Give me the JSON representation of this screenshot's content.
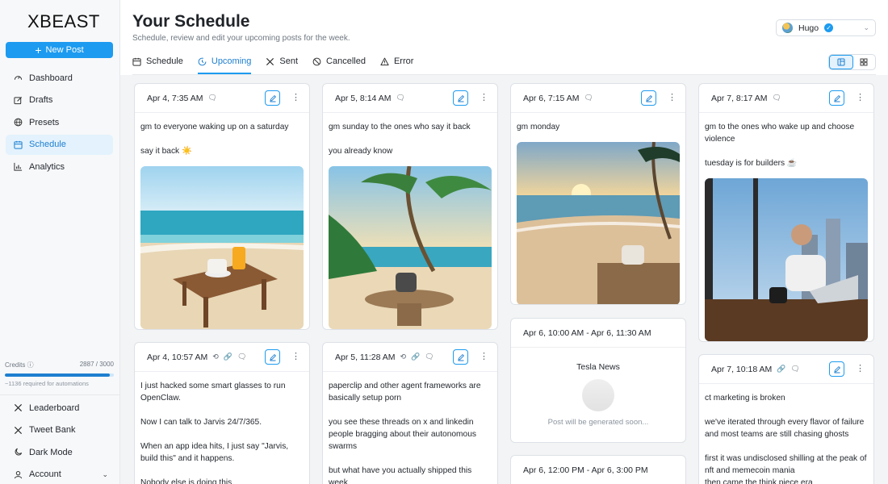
{
  "app": {
    "logo": "XBEAST",
    "new_post": "New Post"
  },
  "nav": [
    {
      "label": "Dashboard",
      "icon": "gauge-icon"
    },
    {
      "label": "Drafts",
      "icon": "pencil-square-icon"
    },
    {
      "label": "Presets",
      "icon": "globe-icon"
    },
    {
      "label": "Schedule",
      "icon": "calendar-icon",
      "active": true
    },
    {
      "label": "Analytics",
      "icon": "bar-chart-icon"
    }
  ],
  "credits": {
    "label": "Credits",
    "value": "2887 / 3000",
    "fraction": 0.962,
    "note": "~1136 required for automations"
  },
  "bottom_nav": [
    {
      "label": "Leaderboard",
      "icon": "x-logo-icon"
    },
    {
      "label": "Tweet Bank",
      "icon": "x-logo-icon"
    },
    {
      "label": "Dark Mode",
      "icon": "moon-icon"
    },
    {
      "label": "Account",
      "icon": "user-icon"
    }
  ],
  "header": {
    "title": "Your Schedule",
    "subtitle": "Schedule, review and edit your upcoming posts for the week."
  },
  "user": {
    "name": "Hugo"
  },
  "tabs": [
    {
      "label": "Schedule"
    },
    {
      "label": "Upcoming",
      "active": true
    },
    {
      "label": "Sent"
    },
    {
      "label": "Cancelled"
    },
    {
      "label": "Error"
    }
  ],
  "accent_color": "#1d9bf0",
  "cards": {
    "c1": {
      "time": "Apr 4, 7:35 AM",
      "lines": [
        "gm to everyone waking up on a saturday",
        "say it back ☀️"
      ]
    },
    "c2": {
      "time": "Apr 5, 8:14 AM",
      "lines": [
        "gm sunday to the ones who say it back",
        "you already know"
      ]
    },
    "c3": {
      "time": "Apr 6, 7:15 AM",
      "lines": [
        "gm monday"
      ]
    },
    "c4": {
      "time": "Apr 7, 8:17 AM",
      "lines": [
        "gm to the ones who wake up and choose violence",
        "tuesday is for builders ☕"
      ]
    },
    "c5": {
      "time": "Apr 4, 10:57 AM",
      "lines": [
        "I just hacked some smart glasses to run OpenClaw.",
        "Now I can talk to Jarvis 24/7/365.",
        "When an app idea hits, I just say \"Jarvis, build this\" and it happens.",
        "Nobody else is doing this."
      ]
    },
    "c6": {
      "time": "Apr 5, 11:28 AM",
      "lines": [
        "paperclip and other agent frameworks are basically setup porn",
        "you see these threads on x and linkedin people bragging about their autonomous swarms",
        "but what have you actually shipped this week"
      ]
    },
    "c7": {
      "time": "Apr 6, 10:00 AM - Apr 6, 11:30 AM",
      "title": "Tesla News",
      "note": "Post will be generated soon..."
    },
    "c8": {
      "time": "Apr 6, 12:00 PM - Apr 6, 3:00 PM"
    },
    "c9": {
      "time": "Apr 7, 10:18 AM",
      "lines": [
        "ct marketing is broken",
        "we've iterated through every flavor of failure and most teams are still chasing ghosts",
        "first it was undisclosed shilling at the peak of nft and memecoin mania",
        "then came the think piece era"
      ]
    }
  }
}
